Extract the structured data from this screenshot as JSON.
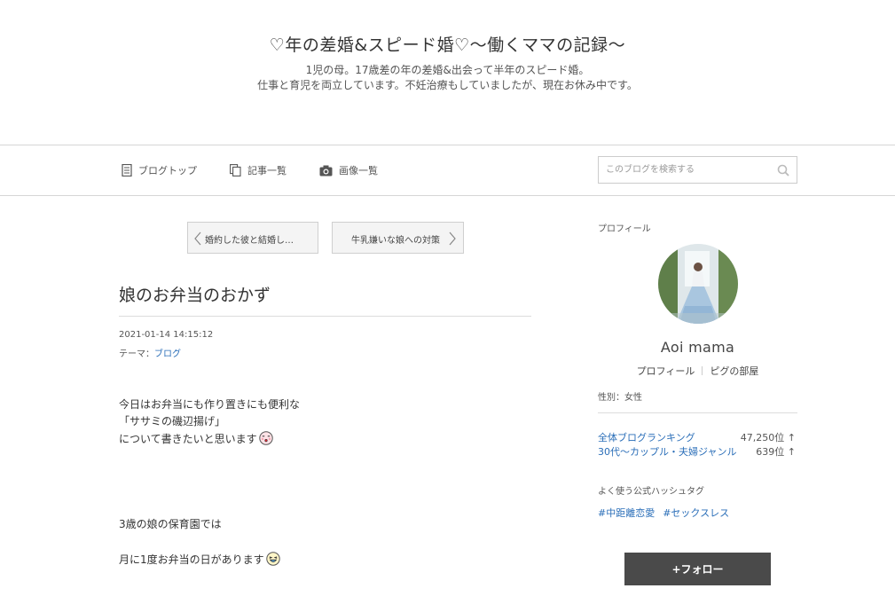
{
  "header": {
    "title": "♡年の差婚&スピード婚♡〜働くママの記録〜",
    "description_lines": [
      "1児の母。17歳差の年の差婚&出会って半年のスピード婚。",
      "仕事と育児を両立しています。不妊治療もしていましたが、現在お休み中です。"
    ]
  },
  "nav": {
    "items": [
      {
        "label": "ブログトップ",
        "icon": "document-icon"
      },
      {
        "label": "記事一覧",
        "icon": "copy-icon"
      },
      {
        "label": "画像一覧",
        "icon": "camera-icon"
      }
    ],
    "search": {
      "placeholder": "このブログを検索する",
      "value": "",
      "icon": "search-icon"
    }
  },
  "pager": {
    "prev_label": "婚約した彼と結婚し…",
    "next_label": "牛乳嫌いな娘への対策"
  },
  "article": {
    "title": "娘のお弁当のおかず",
    "date": "2021-01-14 14:15:12",
    "theme_prefix": "テーマ：",
    "theme": "ブログ",
    "body": [
      "今日はお弁当にも作り置きにも便利な",
      "「ササミの磯辺揚げ」",
      "について書きたいと思います",
      "3歳の娘の保育園では",
      "月に1度お弁当の日があります"
    ],
    "emoji_icons": [
      "kiss-face-emoji-icon",
      "laughing-face-emoji-icon"
    ]
  },
  "sidebar": {
    "profile_heading": "プロフィール",
    "name": "Aoi mama",
    "links": [
      "プロフィール",
      "ピグの部屋"
    ],
    "gender": "性別：女性",
    "rankings": [
      {
        "label": "全体ブログランキング",
        "value": "47,250位",
        "trend": "↑"
      },
      {
        "label": "30代〜カップル・夫婦ジャンル",
        "value": "639位",
        "trend": "↑"
      }
    ],
    "hashtag_heading": "よく使う公式ハッシュタグ",
    "hashtags": [
      "#中距離恋愛",
      "#セックスレス"
    ],
    "follow_label": "+フォロー"
  },
  "colors": {
    "link": "#2a6eb8",
    "follow_button": "#4a4a4a",
    "divider": "#d6d6d6"
  }
}
